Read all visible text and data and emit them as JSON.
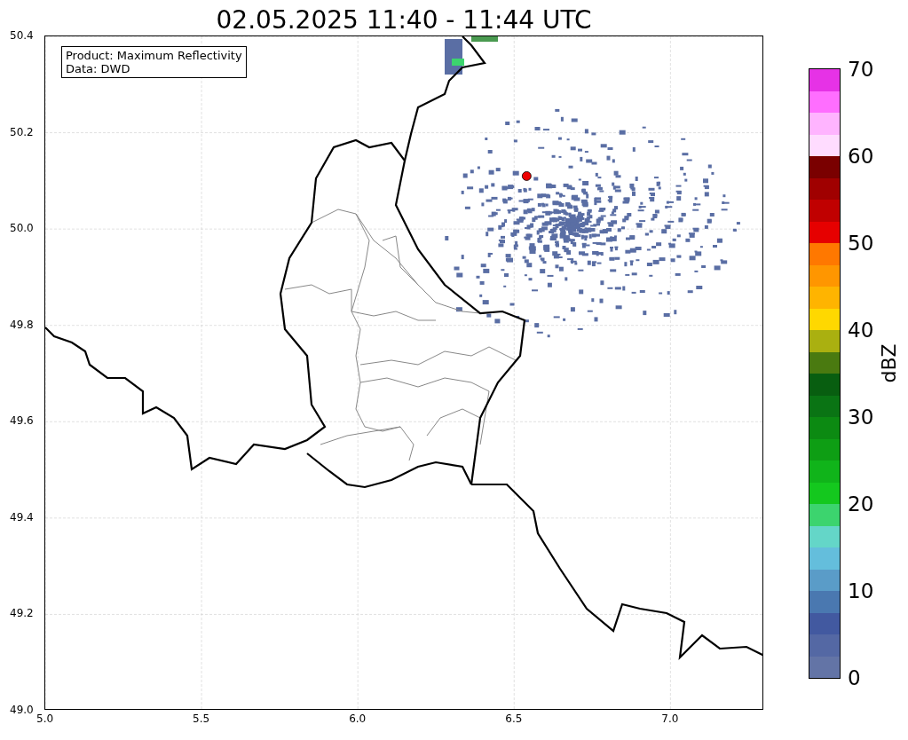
{
  "title": "02.05.2025 11:40 - 11:44 UTC",
  "info_box": [
    "Product: Maximum Reflectivity",
    "Data: DWD"
  ],
  "map": {
    "x_ticks": [
      "5.0",
      "5.5",
      "6.0",
      "6.5",
      "7.0"
    ],
    "y_ticks": [
      "50.4",
      "50.2",
      "50.0",
      "49.8",
      "49.6",
      "49.4",
      "49.2",
      "49.0"
    ]
  },
  "colorbar": {
    "label": "dBZ",
    "ticks": [
      "70",
      "60",
      "50",
      "40",
      "30",
      "20",
      "10",
      "0"
    ],
    "bands": [
      {
        "color": "#6374a6"
      },
      {
        "color": "#5468a4"
      },
      {
        "color": "#4259a0"
      },
      {
        "color": "#4a78b0"
      },
      {
        "color": "#5a9cc8"
      },
      {
        "color": "#64bedc"
      },
      {
        "color": "#64d6c8"
      },
      {
        "color": "#3cd46e"
      },
      {
        "color": "#14c81e"
      },
      {
        "color": "#10b41a"
      },
      {
        "color": "#0e9e14"
      },
      {
        "color": "#0c8a12"
      },
      {
        "color": "#0a7414"
      },
      {
        "color": "#085e10"
      },
      {
        "color": "#4a7a10"
      },
      {
        "color": "#aab010"
      },
      {
        "color": "#ffd800"
      },
      {
        "color": "#ffb400"
      },
      {
        "color": "#ff9600"
      },
      {
        "color": "#ff7800"
      },
      {
        "color": "#e60000"
      },
      {
        "color": "#c00000"
      },
      {
        "color": "#a00000"
      },
      {
        "color": "#7a0000"
      },
      {
        "color": "#ffdcff"
      },
      {
        "color": "#ffb4ff"
      },
      {
        "color": "#ff6eff"
      },
      {
        "color": "#e632e6"
      }
    ]
  }
}
